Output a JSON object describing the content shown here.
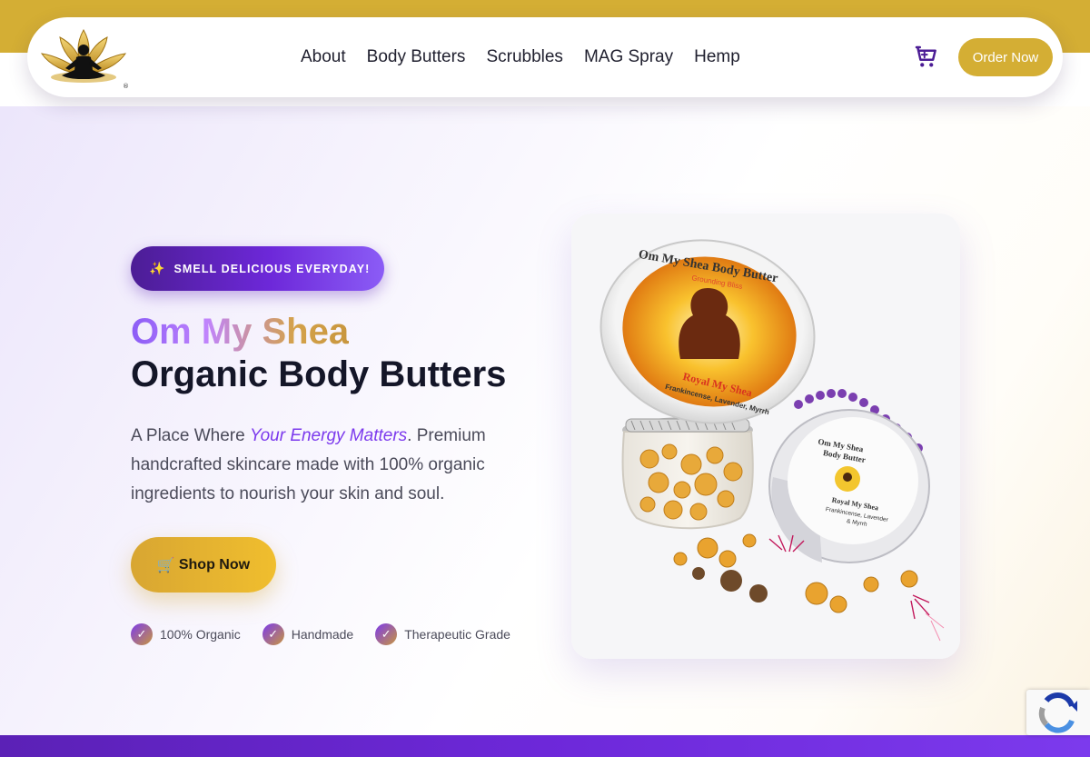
{
  "brand": {
    "logo_icon": "lotus-meditation-logo"
  },
  "nav": {
    "items": [
      "About",
      "Body Butters",
      "Scrubbles",
      "MAG Spray",
      "Hemp"
    ]
  },
  "header": {
    "cart_icon": "cart-icon",
    "order_label": "Order Now"
  },
  "hero": {
    "badge_icon": "sparkles-icon",
    "badge_text": "SMELL DELICIOUS EVERYDAY!",
    "title_line1": "Om My Shea",
    "title_line2": "Organic Body Butters",
    "lead_before": "A Place Where ",
    "lead_emphasis": "Your Energy Matters",
    "lead_after": ". Premium handcrafted skincare made with 100% organic ingredients to nourish your skin and soul.",
    "shop_icon": "🛒",
    "shop_label": "Shop Now",
    "features": [
      "100% Organic",
      "Handmade",
      "Therapeutic Grade"
    ],
    "check_glyph": "✓"
  },
  "product_image": {
    "jar_label_main": "Om My Shea Body Butter",
    "jar_label_sub": "Grounding Bliss",
    "jar_label_name": "Royal My Shea",
    "jar_label_scent": "Frankincense, Lavender, Myrrh",
    "small_jar_title_1": "Om My Shea",
    "small_jar_title_2": "Body Butter",
    "small_jar_name": "Royal My Shea",
    "small_jar_scent_1": "Frankincense, Lavender",
    "small_jar_scent_2": "& Myrrh"
  },
  "colors": {
    "gold": "#d4ae34",
    "purple": "#6d28d9",
    "dark_text": "#141628"
  }
}
